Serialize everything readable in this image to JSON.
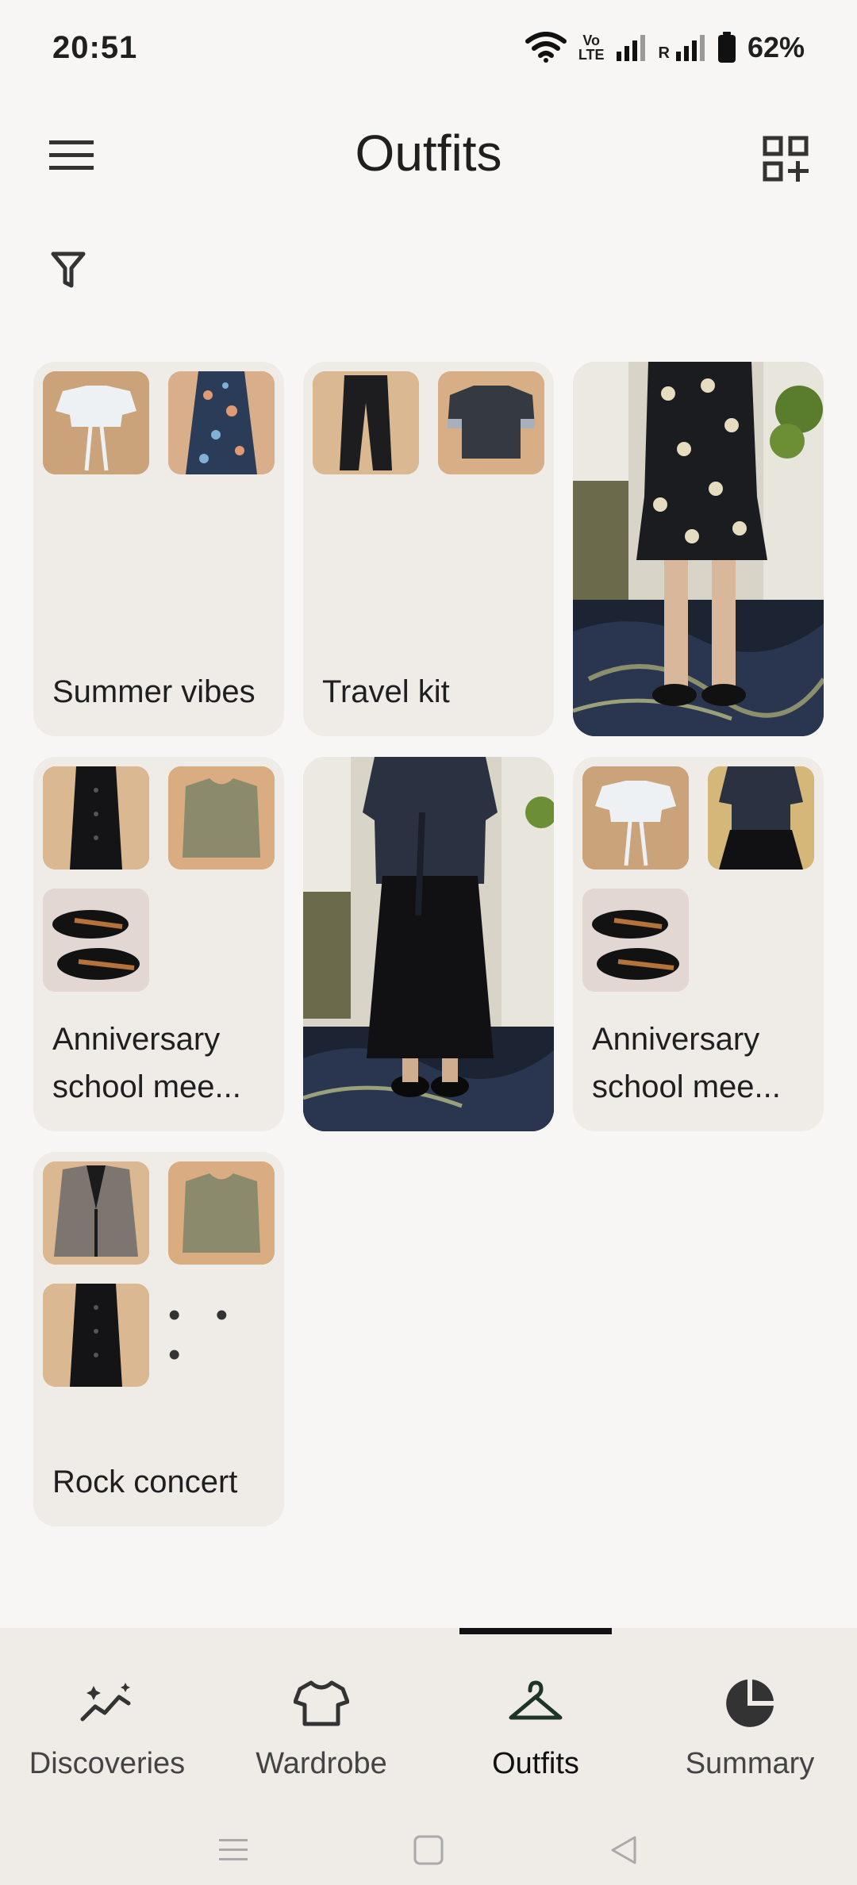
{
  "status_bar": {
    "time": "20:51",
    "volte_label_top": "Vo",
    "volte_label_bottom": "LTE",
    "roaming": "R",
    "battery": "62%"
  },
  "app_bar": {
    "title": "Outfits",
    "menu_icon": "menu-icon",
    "add_icon": "grid-add-icon",
    "filter_icon": "filter-icon"
  },
  "outfits": [
    {
      "label": "Summer vibes",
      "thumbs": [
        "white-crop-top",
        "floral-skirt"
      ]
    },
    {
      "label": "Travel kit",
      "thumbs": [
        "black-trousers",
        "grey-tee"
      ]
    },
    {
      "label": "",
      "photo": "floral-dress-photo"
    },
    {
      "label": "Anniversary school mee...",
      "thumbs": [
        "black-skirt",
        "olive-vest",
        "black-shoes"
      ]
    },
    {
      "label": "",
      "photo": "navy-top-black-skirt-photo"
    },
    {
      "label": "Anniversary school mee...",
      "thumbs": [
        "white-crop-top",
        "navy-blouse",
        "black-shoes"
      ]
    },
    {
      "label": "Rock concert",
      "thumbs": [
        "tweed-jacket",
        "olive-vest",
        "black-skirt"
      ],
      "more": "• • •"
    }
  ],
  "nav": {
    "items": [
      {
        "label": "Discoveries",
        "icon": "sparkline-icon"
      },
      {
        "label": "Wardrobe",
        "icon": "shirt-icon"
      },
      {
        "label": "Outfits",
        "icon": "hanger-icon"
      },
      {
        "label": "Summary",
        "icon": "pie-chart-icon"
      }
    ],
    "active": "Outfits"
  },
  "colors": {
    "background": "#f7f6f4",
    "card": "#efece8",
    "thumb_bg": "#d9b48f",
    "text": "#1f1f1f"
  }
}
